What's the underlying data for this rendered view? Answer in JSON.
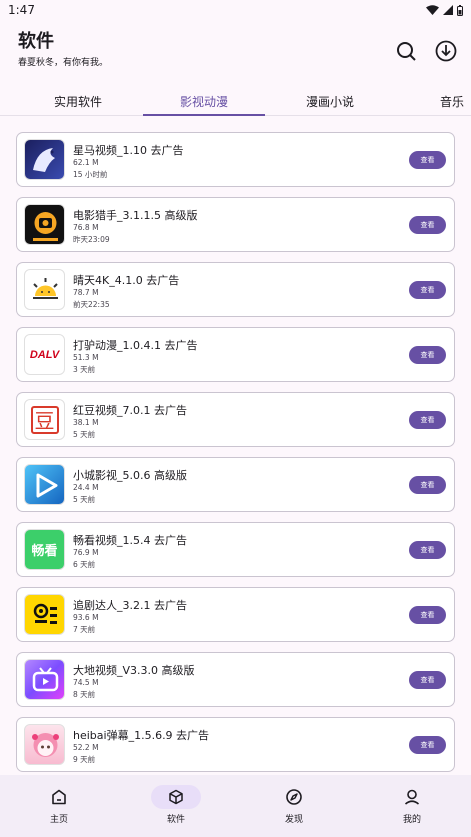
{
  "status_bar": {
    "time": "1:47"
  },
  "header": {
    "title": "软件",
    "subtitle": "春夏秋冬，有你有我。"
  },
  "tabs": [
    {
      "label": "实用软件"
    },
    {
      "label": "影视动漫"
    },
    {
      "label": "漫画小说"
    },
    {
      "label": "音乐"
    }
  ],
  "active_tab": "影视动漫",
  "apps": [
    {
      "name": "星马视频_1.10 去广告",
      "size": "62.1 M",
      "time": "15 小时前",
      "button": "查看",
      "icon": "horse-icon"
    },
    {
      "name": "电影猎手_3.1.1.5 高级版",
      "size": "76.8 M",
      "time": "昨天23:09",
      "button": "查看",
      "icon": "film-hunter-icon"
    },
    {
      "name": "晴天4K_4.1.0 去广告",
      "size": "78.7 M",
      "time": "前天22:35",
      "button": "查看",
      "icon": "sun-icon"
    },
    {
      "name": "打驴动漫_1.0.4.1 去广告",
      "size": "51.3 M",
      "time": "3 天前",
      "button": "查看",
      "icon": "dalv-icon"
    },
    {
      "name": "红豆视频_7.0.1 去广告",
      "size": "38.1 M",
      "time": "5 天前",
      "button": "查看",
      "icon": "red-bean-icon"
    },
    {
      "name": "小城影视_5.0.6 高级版",
      "size": "24.4 M",
      "time": "5 天前",
      "button": "查看",
      "icon": "play-icon"
    },
    {
      "name": "畅看视频_1.5.4 去广告",
      "size": "76.9 M",
      "time": "6 天前",
      "button": "查看",
      "icon": "changkan-icon"
    },
    {
      "name": "追剧达人_3.2.1 去广告",
      "size": "93.6 M",
      "time": "7 天前",
      "button": "查看",
      "icon": "drama-icon"
    },
    {
      "name": "大地视频_V3.3.0 高级版",
      "size": "74.5 M",
      "time": "8 天前",
      "button": "查看",
      "icon": "tv-icon"
    },
    {
      "name": "heibai弹幕_1.5.6.9 去广告",
      "size": "52.2 M",
      "time": "9 天前",
      "button": "查看",
      "icon": "anime-girl-icon"
    }
  ],
  "icon_texts": {
    "dalv": "DALV",
    "red_bean": "豆",
    "changkan": "畅看"
  },
  "bottom_nav": [
    {
      "label": "主页",
      "icon": "home-icon"
    },
    {
      "label": "软件",
      "icon": "cube-icon"
    },
    {
      "label": "发现",
      "icon": "compass-icon"
    },
    {
      "label": "我的",
      "icon": "person-icon"
    }
  ],
  "active_nav": "软件",
  "colors": {
    "accent": "#6750a4",
    "background": "#fdf7fc",
    "nav_pill": "#e8def8"
  }
}
